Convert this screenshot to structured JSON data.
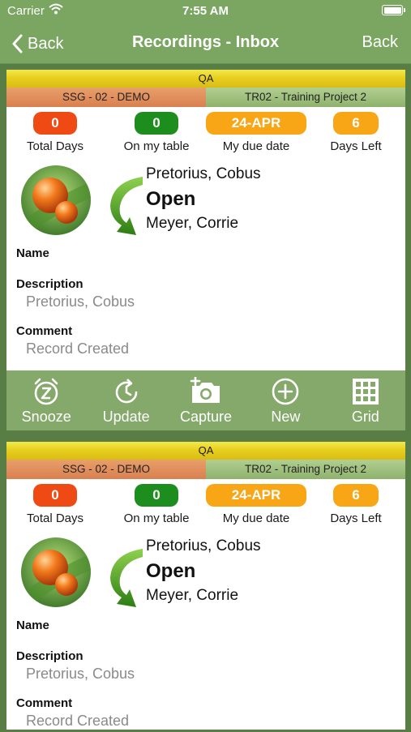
{
  "status_bar": {
    "carrier": "Carrier",
    "time": "7:55 AM"
  },
  "nav": {
    "back_left": "Back",
    "title": "Recordings - Inbox",
    "back_right": "Back"
  },
  "records": [
    {
      "category": "QA",
      "organization": "SSG - 02 - DEMO",
      "project": "TR02 - Training Project 2",
      "stats": [
        {
          "value": "0",
          "label": "Total Days",
          "color": "#ef4a14"
        },
        {
          "value": "0",
          "label": "On my table",
          "color": "#1d8d1d"
        },
        {
          "value": "24-APR",
          "label": "My due date",
          "color": "#f8a616"
        },
        {
          "value": "6",
          "label": "Days Left",
          "color": "#f8a616"
        }
      ],
      "from": "Pretorius, Cobus",
      "status": "Open",
      "to": "Meyer, Corrie",
      "name_label": "Name",
      "name_value": "",
      "description_label": "Description",
      "description_value": "Pretorius, Cobus",
      "comment_label": "Comment",
      "comment_value": "Record Created"
    },
    {
      "category": "QA",
      "organization": "SSG - 02 - DEMO",
      "project": "TR02 - Training Project 2",
      "stats": [
        {
          "value": "0",
          "label": "Total Days",
          "color": "#ef4a14"
        },
        {
          "value": "0",
          "label": "On my table",
          "color": "#1d8d1d"
        },
        {
          "value": "24-APR",
          "label": "My due date",
          "color": "#f8a616"
        },
        {
          "value": "6",
          "label": "Days Left",
          "color": "#f8a616"
        }
      ],
      "from": "Pretorius, Cobus",
      "status": "Open",
      "to": "Meyer, Corrie",
      "name_label": "Name",
      "name_value": "",
      "description_label": "Description",
      "description_value": "Pretorius, Cobus",
      "comment_label": "Comment",
      "comment_value": "Record Created"
    }
  ],
  "toolbar": [
    {
      "label": "Snooze",
      "icon": "snooze-clock-icon"
    },
    {
      "label": "Update",
      "icon": "refresh-clock-icon"
    },
    {
      "label": "Capture",
      "icon": "camera-add-icon"
    },
    {
      "label": "New",
      "icon": "plus-circle-icon"
    },
    {
      "label": "Grid",
      "icon": "grid-icon"
    }
  ],
  "colors": {
    "nav_background": "#7aa661",
    "toolbar_background": "#84a96a",
    "category_bar": "#e8cf1e",
    "organization_bar": "#d9804f",
    "project_bar": "#8eb26c"
  }
}
